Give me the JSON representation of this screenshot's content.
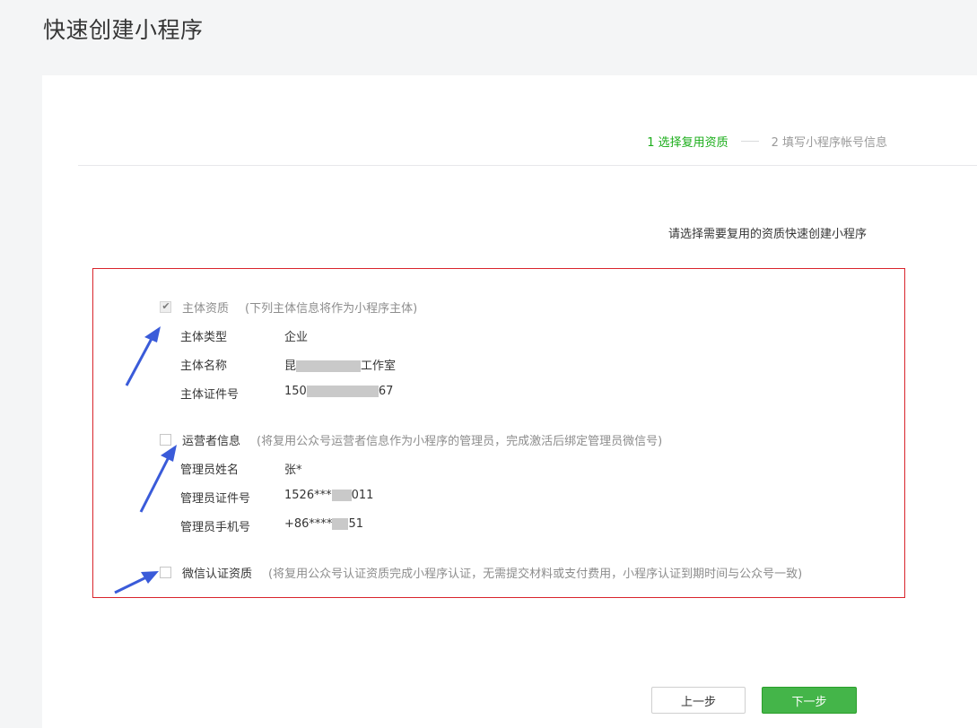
{
  "page_title": "快速创建小程序",
  "steps": {
    "step1": "1 选择复用资质",
    "step2": "2 填写小程序帐号信息"
  },
  "hint": "请选择需要复用的资质快速创建小程序",
  "options": {
    "entity": {
      "label": "主体资质",
      "desc": "(下列主体信息将作为小程序主体)",
      "checked": true,
      "fields": [
        {
          "key": "主体类型",
          "value": "企业"
        },
        {
          "key": "主体名称",
          "value_prefix": "昆",
          "value_suffix": "工作室"
        },
        {
          "key": "主体证件号",
          "value_prefix": "150",
          "value_suffix": "67"
        }
      ]
    },
    "operator": {
      "label": "运营者信息",
      "desc": "(将复用公众号运营者信息作为小程序的管理员，完成激活后绑定管理员微信号)",
      "checked": false,
      "fields": [
        {
          "key": "管理员姓名",
          "value": "张*"
        },
        {
          "key": "管理员证件号",
          "value_prefix": "1526***",
          "value_suffix": "011"
        },
        {
          "key": "管理员手机号",
          "value_prefix": "+86****",
          "value_suffix": "51"
        }
      ]
    },
    "wechat_cert": {
      "label": "微信认证资质",
      "desc": "(将复用公众号认证资质完成小程序认证，无需提交材料或支付费用，小程序认证到期时间与公众号一致)",
      "checked": false
    }
  },
  "buttons": {
    "prev": "上一步",
    "next": "下一步"
  },
  "colors": {
    "accent_green": "#1aad19",
    "button_green": "#44b549",
    "highlight_border": "#d9242c",
    "annotation_arrow": "#3a5bd9"
  }
}
